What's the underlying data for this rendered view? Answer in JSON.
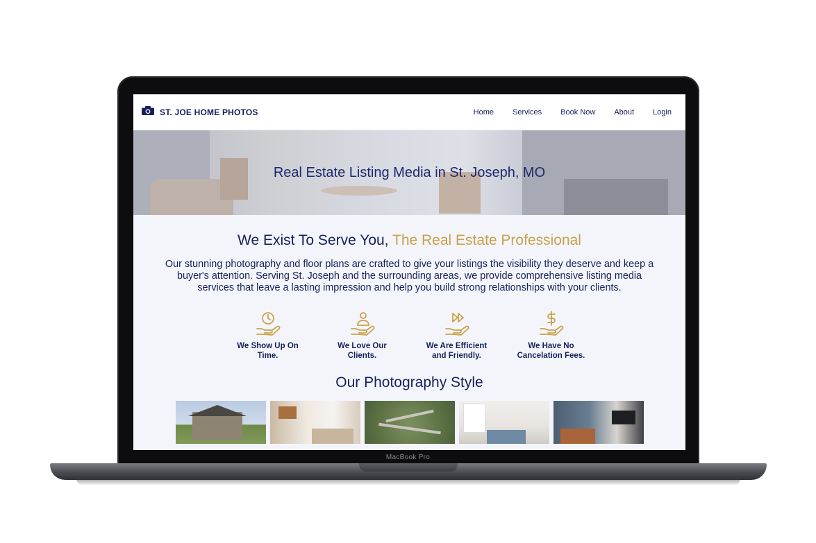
{
  "device": {
    "label": "MacBook Pro"
  },
  "site": {
    "logo": {
      "icon": "camera-icon",
      "text": "ST. JOE HOME PHOTOS"
    },
    "nav": [
      {
        "label": "Home"
      },
      {
        "label": "Services"
      },
      {
        "label": "Book Now"
      },
      {
        "label": "About"
      },
      {
        "label": "Login"
      }
    ],
    "hero": {
      "title": "Real Estate Listing Media in St. Joseph, MO"
    },
    "headline": {
      "main": "We Exist To Serve You,",
      "accent": "The Real Estate Professional"
    },
    "intro": "Our stunning photography and floor plans are crafted to give your listings the visibility they deserve and keep a buyer's attention. Serving St. Joseph and the surrounding areas, we provide comprehensive listing media services that leave a lasting impression and help you build strong relationships with your clients.",
    "features": [
      {
        "icon": "clock-hand-icon",
        "label": "We Show Up On Time."
      },
      {
        "icon": "person-hand-icon",
        "label": "We Love Our Clients."
      },
      {
        "icon": "fast-forward-hand-icon",
        "label": "We Are Efficient and Friendly."
      },
      {
        "icon": "dollar-hand-icon",
        "label": "We Have No Cancelation Fees."
      }
    ],
    "photography_title": "Our Photography Style",
    "photos": [
      {
        "icon": "house-exterior-photo"
      },
      {
        "icon": "living-room-photo"
      },
      {
        "icon": "aerial-neighborhood-photo"
      },
      {
        "icon": "kitchen-photo"
      },
      {
        "icon": "family-room-photo"
      }
    ],
    "colors": {
      "navy": "#14205c",
      "gold": "#c9a14a",
      "background": "#f4f5fb"
    }
  }
}
